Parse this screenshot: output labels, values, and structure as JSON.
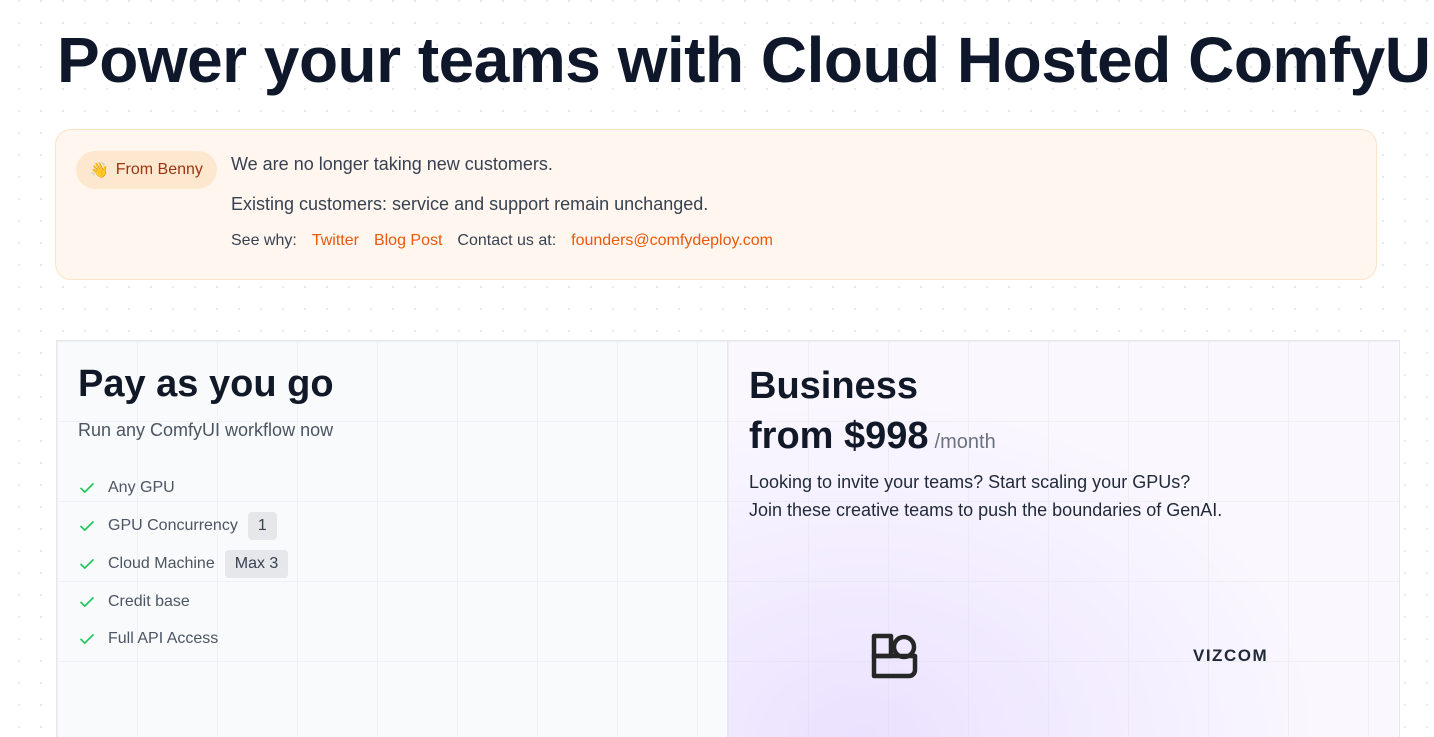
{
  "hero": {
    "title": "Power your teams with Cloud Hosted ComfyUI"
  },
  "notice": {
    "pill_icon": "waving-hand-icon",
    "pill_emoji": "👋",
    "pill_label": "From Benny",
    "line1": "We are no longer taking new customers.",
    "line2": "Existing customers: service and support remain unchanged.",
    "see_why_label": "See why:",
    "twitter_link": "Twitter",
    "blog_link": "Blog Post",
    "contact_label": "Contact us at:",
    "email_link": "founders@comfydeploy.com",
    "link_color": "#ea580c"
  },
  "plans": {
    "pay_as_you_go": {
      "title": "Pay as you go",
      "subtitle": "Run any ComfyUI workflow now",
      "check_color": "#22c55e",
      "features": [
        {
          "label": "Any GPU",
          "tag": ""
        },
        {
          "label": "GPU Concurrency",
          "tag": "1"
        },
        {
          "label": "Cloud Machine",
          "tag": "Max 3"
        },
        {
          "label": "Credit base",
          "tag": ""
        },
        {
          "label": "Full API Access",
          "tag": ""
        }
      ]
    },
    "business": {
      "title": "Business",
      "price": "from $998",
      "period": "/month",
      "desc_line1": "Looking to invite your teams? Start scaling your GPUs?",
      "desc_line2": "Join these creative teams to push the boundaries of GenAI.",
      "logos": [
        {
          "icon": "b-logo-icon"
        },
        {
          "text": "VIZCOM"
        }
      ]
    }
  }
}
